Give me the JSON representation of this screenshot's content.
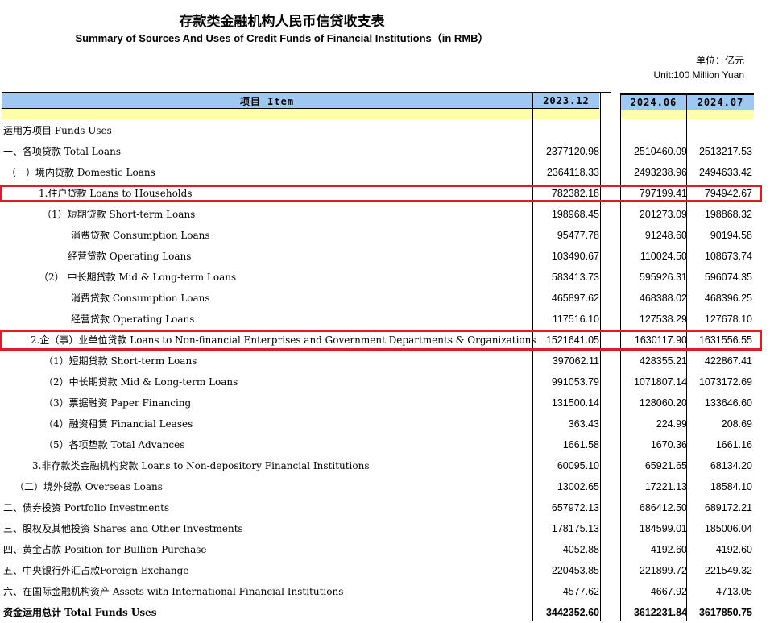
{
  "title_cn": "存款类金融机构人民币信贷收支表",
  "title_en": "Summary of Sources And Uses of Credit Funds of Financial Institutions（in RMB）",
  "unit_cn": "单位：亿元",
  "unit_en": "Unit:100 Million Yuan",
  "columns": {
    "item": "项目 Item",
    "c1": "2023.12",
    "c2": "2024.06",
    "c3": "2024.07"
  },
  "section_label": "运用方项目 Funds Uses",
  "rows": [
    {
      "label": "一、各项贷款 Total Loans",
      "v1": "2377120.98",
      "v2": "2510460.09",
      "v3": "2513217.53"
    },
    {
      "label": "（一）境内贷款 Domestic Loans",
      "v1": "2364118.33",
      "v2": "2493238.96",
      "v3": "2494633.42"
    },
    {
      "label": "1.住户贷款 Loans to Households",
      "v1": "782382.18",
      "v2": "797199.41",
      "v3": "794942.67"
    },
    {
      "label": "（1）短期贷款 Short-term  Loans",
      "v1": "198968.45",
      "v2": "201273.09",
      "v3": "198868.32"
    },
    {
      "label": "消费贷款 Consumption Loans",
      "v1": "95477.78",
      "v2": "91248.60",
      "v3": "90194.58"
    },
    {
      "label": "经营贷款 Operating Loans",
      "v1": "103490.67",
      "v2": "110024.50",
      "v3": "108673.74"
    },
    {
      "label": "（2） 中长期贷款 Mid & Long-term  Loans",
      "v1": "583413.73",
      "v2": "595926.31",
      "v3": "596074.35"
    },
    {
      "label": "消费贷款 Consumption Loans",
      "v1": "465897.62",
      "v2": "468388.02",
      "v3": "468396.25"
    },
    {
      "label": "经营贷款 Operating Loans",
      "v1": "117516.10",
      "v2": "127538.29",
      "v3": "127678.10"
    },
    {
      "label": "2.企（事）业单位贷款 Loans to Non-financial Enterprises and Government Departments & Organizations",
      "v1": "1521641.05",
      "v2": "1630117.90",
      "v3": "1631556.55"
    },
    {
      "label": "（1）短期贷款 Short-term  Loans",
      "v1": "397062.11",
      "v2": "428355.21",
      "v3": "422867.41"
    },
    {
      "label": "（2）中长期贷款 Mid & Long-term Loans",
      "v1": "991053.79",
      "v2": "1071807.14",
      "v3": "1073172.69"
    },
    {
      "label": "（3）票据融资 Paper Financing",
      "v1": "131500.14",
      "v2": "128060.20",
      "v3": "133646.60"
    },
    {
      "label": "（4）融资租赁 Financial Leases",
      "v1": "363.43",
      "v2": "224.99",
      "v3": "208.69"
    },
    {
      "label": "（5）各项垫款 Total Advances",
      "v1": "1661.58",
      "v2": "1670.36",
      "v3": "1661.16"
    },
    {
      "label": "3.非存款类金融机构贷款 Loans to Non-depository Financial Institutions",
      "v1": "60095.10",
      "v2": "65921.65",
      "v3": "68134.20"
    },
    {
      "label": "（二）境外贷款 Overseas Loans",
      "v1": "13002.65",
      "v2": "17221.13",
      "v3": "18584.10"
    },
    {
      "label": "二、债券投资 Portfolio Investments",
      "v1": "657972.13",
      "v2": "686412.50",
      "v3": "689172.21"
    },
    {
      "label": "三、股权及其他投资 Shares and Other Investments",
      "v1": "178175.13",
      "v2": "184599.01",
      "v3": "185006.04"
    },
    {
      "label": "四、黄金占款 Position for Bullion Purchase",
      "v1": "4052.88",
      "v2": "4192.60",
      "v3": "4192.60"
    },
    {
      "label": "五、中央银行外汇占款Foreign Exchange",
      "v1": "220453.85",
      "v2": "221899.72",
      "v3": "221549.32"
    },
    {
      "label": "六、在国际金融机构资产 Assets with International Financial Institutions",
      "v1": "4577.62",
      "v2": "4667.92",
      "v3": "4713.05"
    },
    {
      "label": "资金运用总计 Total Funds Uses",
      "v1": "3442352.60",
      "v2": "3612231.84",
      "v3": "3617850.75"
    }
  ]
}
